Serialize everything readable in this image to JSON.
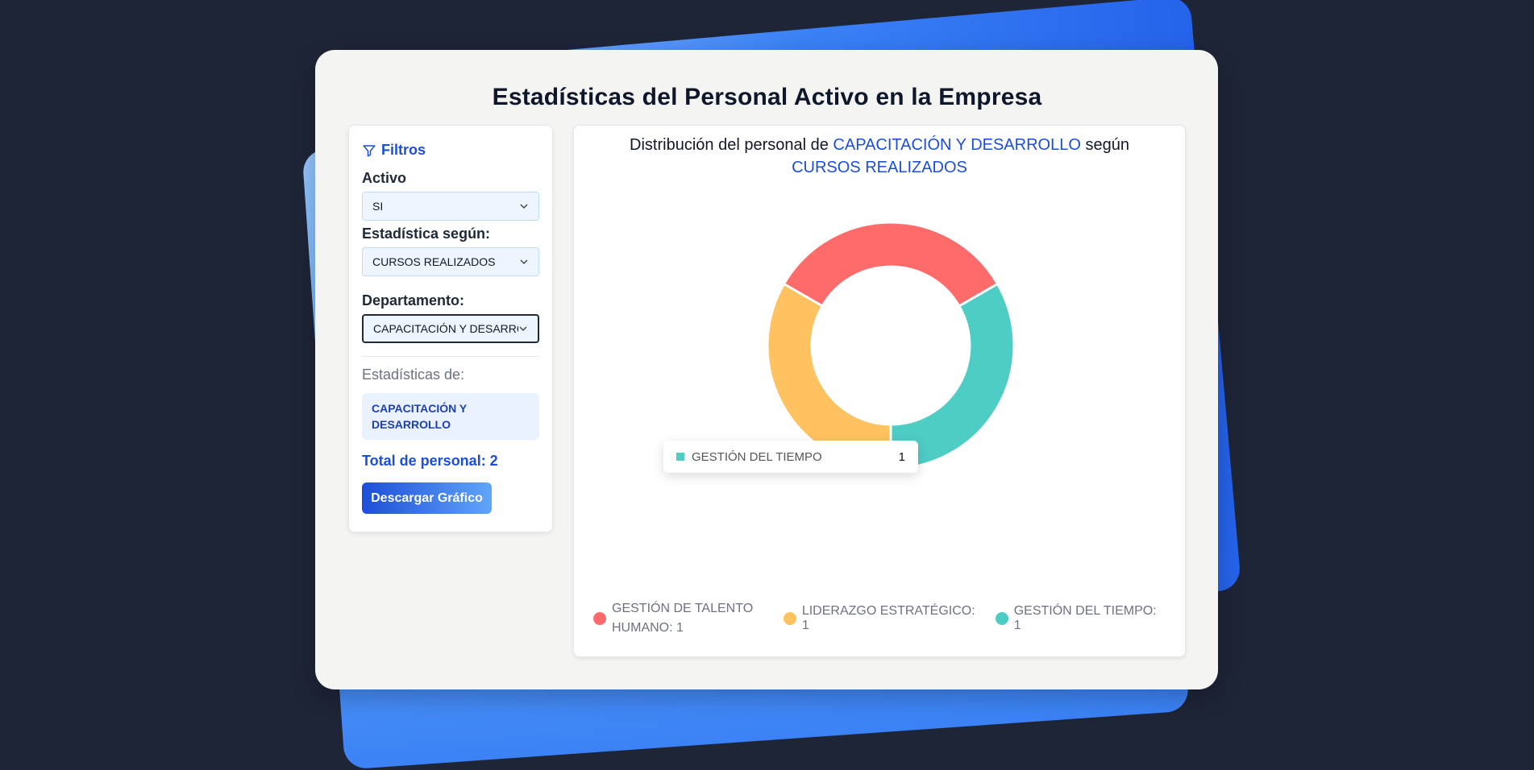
{
  "page": {
    "title": "Estadísticas del Personal Activo en la Empresa"
  },
  "sidebar": {
    "filters_title": "Filtros",
    "active": {
      "label": "Activo",
      "value": "SI"
    },
    "stat_by": {
      "label": "Estadística según:",
      "value": "CURSOS REALIZADOS"
    },
    "department": {
      "label": "Departamento:",
      "value": "CAPACITACIÓN Y DESARROLLO"
    },
    "stats_of_label": "Estadísticas de:",
    "stats_of_value": "CAPACITACIÓN Y DESARROLLO",
    "total_label": "Total de personal: 2",
    "download_label": "Descargar Gráfico"
  },
  "chart": {
    "title_prefix": "Distribución del personal de",
    "title_department": "CAPACITACIÓN Y DESARROLLO",
    "title_middle": "según",
    "title_metric": "CURSOS REALIZADOS",
    "tooltip": {
      "label": "GESTIÓN DEL TIEMPO",
      "value": "1"
    },
    "legend": [
      {
        "text": "GESTIÓN DE TALENTO HUMANO: 1"
      },
      {
        "text": "LIDERAZGO ESTRATÉGICO: 1"
      },
      {
        "text": "GESTIÓN DEL TIEMPO: 1"
      }
    ]
  },
  "chart_data": {
    "type": "pie",
    "categories": [
      "GESTIÓN DE TALENTO HUMANO",
      "GESTIÓN DEL TIEMPO",
      "LIDERAZGO ESTRATÉGICO"
    ],
    "values": [
      1,
      1,
      1
    ],
    "colors": [
      "#ff6b6b",
      "#4ecdc4",
      "#fec260"
    ],
    "hole": 0.64,
    "legend_position": "bottom"
  }
}
